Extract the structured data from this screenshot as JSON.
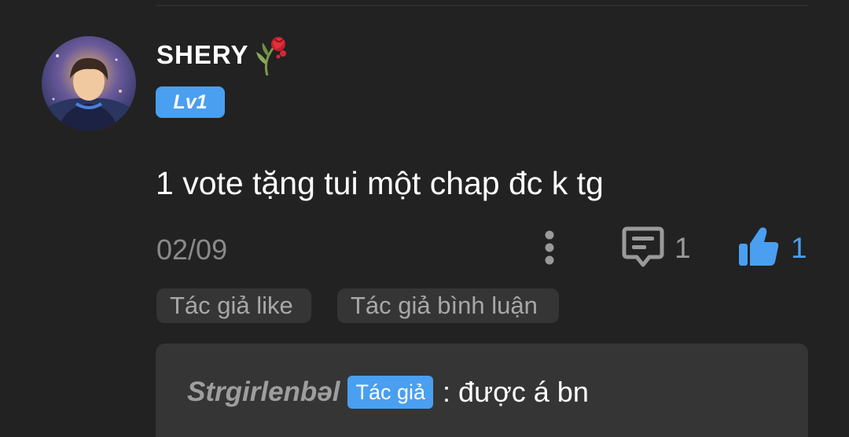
{
  "comment": {
    "username": "SHERY",
    "level": "Lv1",
    "text": "1 vote tặng tui một chap đc k tg",
    "date": "02/09",
    "reply_count": "1",
    "like_count": "1"
  },
  "tags": {
    "author_like": "Tác giả like",
    "author_reply": "Tác giả bình luận"
  },
  "reply": {
    "author": "Strgirlenbəl",
    "badge": "Tác giả",
    "separator": ":",
    "text": "được á bn"
  },
  "colors": {
    "background": "#222222",
    "accent": "#4a9ff0",
    "tag_background": "#353535",
    "muted_text": "#8a8a8a"
  },
  "icons": {
    "username_decoration": "wilted-rose-icon",
    "more": "more-vertical-icon",
    "reply": "comment-bubble-icon",
    "like": "thumbs-up-icon"
  }
}
